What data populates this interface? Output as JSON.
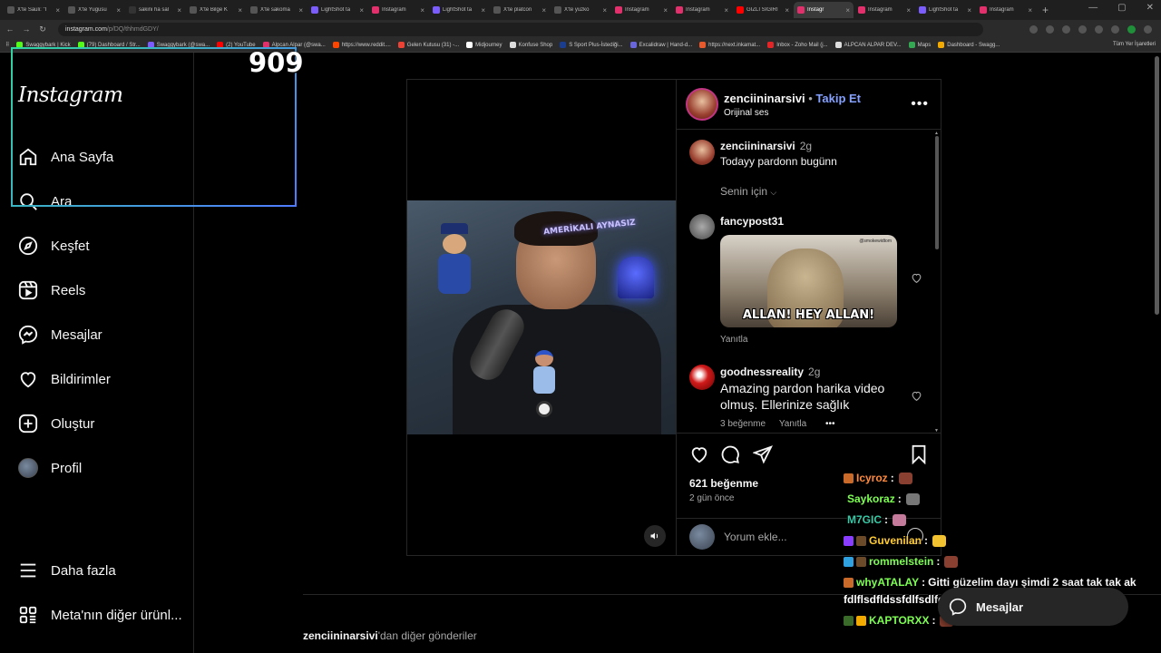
{
  "browser": {
    "tabs": [
      {
        "label": "X'te Sauli: \"I",
        "color": "#555"
      },
      {
        "label": "X'te Yugusu",
        "color": "#555"
      },
      {
        "label": "sakini ha sal",
        "color": "#333"
      },
      {
        "label": "X'te Bilge K",
        "color": "#555"
      },
      {
        "label": "X'te sakoma",
        "color": "#555"
      },
      {
        "label": "LightShot ta",
        "color": "#7b5cff"
      },
      {
        "label": "Instagram",
        "color": "#e1306c"
      },
      {
        "label": "LightShot ta",
        "color": "#7b5cff"
      },
      {
        "label": "X'te platcon",
        "color": "#555"
      },
      {
        "label": "X'te yuzko",
        "color": "#555"
      },
      {
        "label": "Instagram",
        "color": "#e1306c"
      },
      {
        "label": "Instagram",
        "color": "#e1306c"
      },
      {
        "label": "GIZLI SIGIRI",
        "color": "#ff0000"
      },
      {
        "label": "Instagr",
        "color": "#e1306c",
        "active": true
      },
      {
        "label": "Instagram",
        "color": "#e1306c"
      },
      {
        "label": "LightShot ta",
        "color": "#7b5cff"
      },
      {
        "label": "Instagram",
        "color": "#e1306c"
      }
    ],
    "url_host": "instagram.com",
    "url_path": "/p/DQ/thhmdGDY/",
    "bookmarks": [
      {
        "label": "Swaggybark | Kick",
        "color": "#53fc18"
      },
      {
        "label": "(79) Dashboard / Str...",
        "color": "#53fc18"
      },
      {
        "label": "Swaggybark (@swa...",
        "color": "#7b5cff"
      },
      {
        "label": "(2) YouTube",
        "color": "#ff0000"
      },
      {
        "label": "Alpcan Alpar (@swa...",
        "color": "#e1306c"
      },
      {
        "label": "https://www.reddit....",
        "color": "#ff4500"
      },
      {
        "label": "Gelen Kutusu (31) -...",
        "color": "#ea4335"
      },
      {
        "label": "Midjourney",
        "color": "#fff"
      },
      {
        "label": "Konfuse Shop",
        "color": "#ddd"
      },
      {
        "label": "S Sport Plus-İstediği...",
        "color": "#1a3d8f"
      },
      {
        "label": "Excalidraw | Hand-d...",
        "color": "#6965db"
      },
      {
        "label": "https://next.inkamat...",
        "color": "#e85a2c"
      },
      {
        "label": "Inbox - Zoho Mail (j...",
        "color": "#e42527"
      },
      {
        "label": "ALPCAN ALPAR DEV...",
        "color": "#ddd"
      },
      {
        "label": "Maps",
        "color": "#34a853"
      },
      {
        "label": "Dashboard - Swagg...",
        "color": "#f2a900"
      }
    ],
    "all_bookmarks": "Tüm Yer İşaretleri"
  },
  "overlay": {
    "counter": "909"
  },
  "sidebar": {
    "logo": "Instagram",
    "items": [
      {
        "label": "Ana Sayfa",
        "icon": "home-icon"
      },
      {
        "label": "Ara",
        "icon": "search-icon"
      },
      {
        "label": "Keşfet",
        "icon": "compass-icon"
      },
      {
        "label": "Reels",
        "icon": "reels-icon"
      },
      {
        "label": "Mesajlar",
        "icon": "messenger-icon"
      },
      {
        "label": "Bildirimler",
        "icon": "heart-icon"
      },
      {
        "label": "Oluştur",
        "icon": "plus-square-icon"
      },
      {
        "label": "Profil",
        "icon": "avatar"
      }
    ],
    "more": "Daha fazla",
    "meta": "Meta'nın diğer ürünl..."
  },
  "post": {
    "video_text": "AMERİKALI AYNASIZ",
    "username": "zenciininarsivi",
    "dot": "•",
    "follow": "Takip Et",
    "audio": "Orijinal ses",
    "caption": {
      "user": "zenciininarsivi",
      "time": "2g",
      "text": "Todayy pardonn bugünn"
    },
    "for_you": "Senin için",
    "comments": [
      {
        "user": "fancypost31",
        "gif_caption": "ALLAN! HEY ALLAN!",
        "gif_watermark": "@smokewidtom",
        "reply": "Yanıtla"
      },
      {
        "user": "goodnessreality",
        "time": "2g",
        "text_1": "Amazing pardon harika video",
        "text_2": "olmuş. Ellerinize sağlık",
        "likes": "3 beğenme",
        "reply": "Yanıtla",
        "more": "•••"
      }
    ],
    "likes": "621 beğenme",
    "ago": "2 gün önce",
    "comment_placeholder": "Yorum ekle..."
  },
  "footer": {
    "more_posts_user": "zenciininarsivi",
    "more_posts_suffix": "'dan diğer gönderiler"
  },
  "chat": [
    {
      "user": "Icyroz",
      "color": "#ff8a3d",
      "msg": ""
    },
    {
      "user": "Saykoraz",
      "color": "#7dff52",
      "msg": ""
    },
    {
      "user": "M7GIC",
      "color": "#37c9a6",
      "msg": ""
    },
    {
      "user": "Guvenilan",
      "color": "#ffcc33",
      "msg": ""
    },
    {
      "user": "rommelstein",
      "color": "#7dff52",
      "msg": ""
    },
    {
      "user": "whyATALAY",
      "color": "#7dff52",
      "msg": "Gitti güzelim dayı şimdi 2 saat tak tak ak"
    },
    {
      "user": "",
      "color": "#ffffff",
      "msg": "fdlflsdfldssfdlfsdlfds"
    },
    {
      "user": "KAPTORXX",
      "color": "#7dff52",
      "msg": ""
    }
  ],
  "messages_pill": "Mesajlar"
}
